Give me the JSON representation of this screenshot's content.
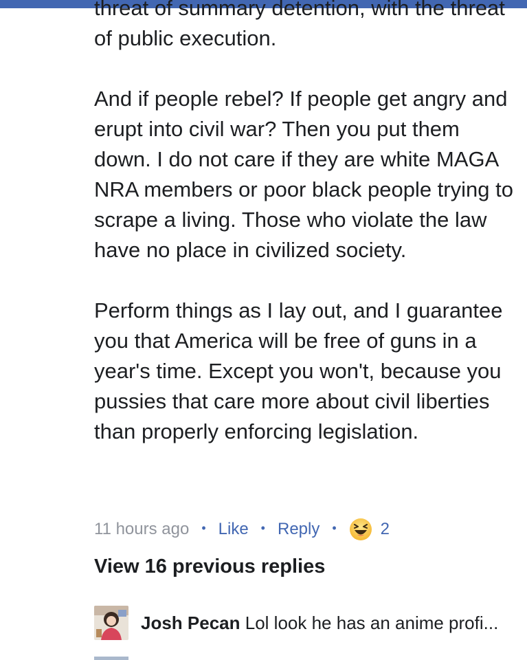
{
  "comment": {
    "paragraphs": [
      "threat of summary detention, with the threat of public execution.",
      "And if people rebel? If people get angry and erupt into civil war? Then you put them down. I do not care if they are white MAGA NRA members or poor black people trying to scrape a living. Those who violate the law have no place in civilized society.",
      "Perform things as I lay out, and I guarantee you that America will be free of guns in a year's time. Except you won't, because you pussies that care more about civil liberties than properly enforcing legislation."
    ],
    "timestamp": "11 hours ago",
    "like_label": "Like",
    "reply_label": "Reply",
    "separator": "•",
    "reaction": {
      "icon": "haha-emoji-icon",
      "count": "2"
    }
  },
  "view_previous_replies": "View 16 previous replies",
  "reply_preview": {
    "author": "Josh Pecan",
    "snippet": "Lol look he has an anime profi..."
  },
  "colors": {
    "top_bar": "#4267b2",
    "link": "#4267b2",
    "muted": "#90949c",
    "text": "#1c1e21",
    "haha_yellow": "#f7c948"
  }
}
